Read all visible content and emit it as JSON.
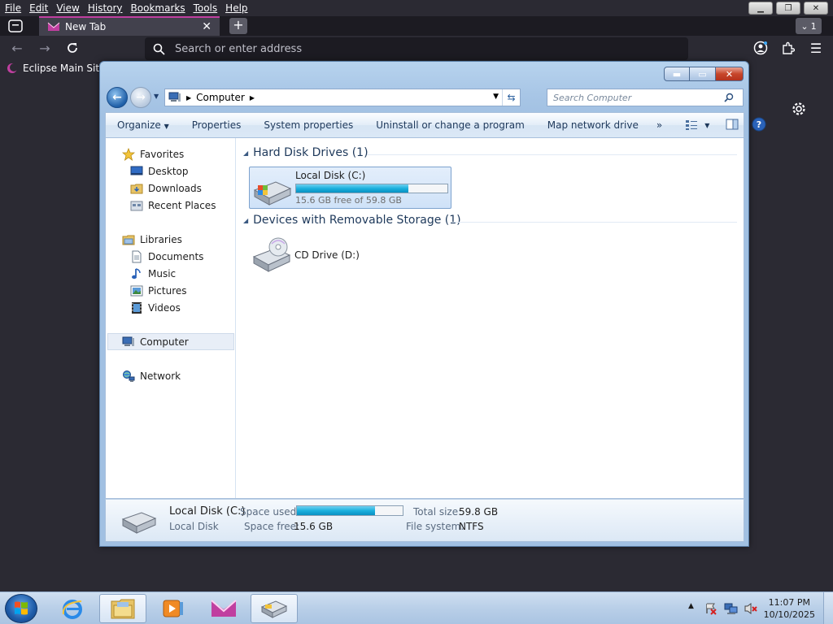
{
  "browser": {
    "menu": [
      "File",
      "Edit",
      "View",
      "History",
      "Bookmarks",
      "Tools",
      "Help"
    ],
    "tab_title": "New Tab",
    "tab_count": "1",
    "url_placeholder": "Search or enter address",
    "bookmark": "Eclipse Main Site",
    "accent": "#c03fa0"
  },
  "explorer": {
    "breadcrumb": "Computer",
    "search_placeholder": "Search Computer",
    "commands": [
      "Organize",
      "Properties",
      "System properties",
      "Uninstall or change a program",
      "Map network drive"
    ],
    "nav": {
      "favorites": "Favorites",
      "desktop": "Desktop",
      "downloads": "Downloads",
      "recent": "Recent Places",
      "libraries": "Libraries",
      "documents": "Documents",
      "music": "Music",
      "pictures": "Pictures",
      "videos": "Videos",
      "computer": "Computer",
      "network": "Network"
    },
    "groups": {
      "hdd": "Hard Disk Drives (1)",
      "removable": "Devices with Removable Storage (1)"
    },
    "drive_c": {
      "name": "Local Disk (C:)",
      "free_text": "15.6 GB free of 59.8 GB",
      "used_fraction": 0.74
    },
    "drive_d": {
      "name": "CD Drive (D:)"
    },
    "details": {
      "name": "Local Disk (C:)",
      "type": "Local Disk",
      "space_used_label": "Space used:",
      "space_free_label": "Space free:",
      "space_free": "15.6 GB",
      "total_size_label": "Total size:",
      "total_size": "59.8 GB",
      "file_system_label": "File system:",
      "file_system": "NTFS",
      "used_fraction": 0.74
    }
  },
  "taskbar": {
    "time": "11:07 PM",
    "date": "10/10/2025"
  }
}
